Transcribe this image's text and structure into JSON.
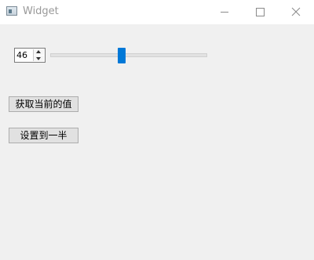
{
  "window": {
    "title": "Widget",
    "icon": "app-window-icon",
    "controls": [
      "minimize-icon",
      "maximize-icon",
      "close-icon"
    ]
  },
  "spinbox": {
    "value": "46"
  },
  "slider": {
    "value": 46,
    "min": 0,
    "max": 100,
    "accent_color": "#0078d7"
  },
  "buttons": {
    "get_value_label": "获取当前的值",
    "set_half_label": "设置到一半"
  }
}
